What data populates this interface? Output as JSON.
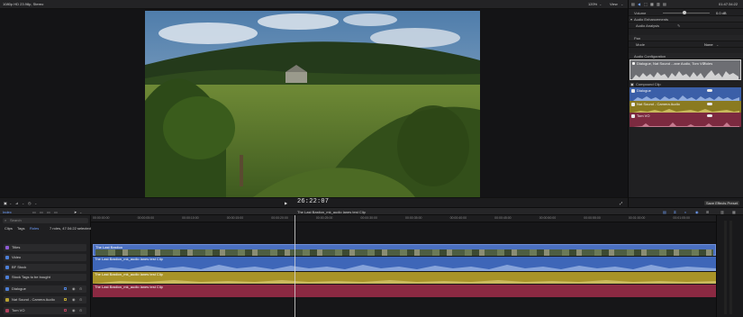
{
  "viewer": {
    "format_label": "1080p HD 23.98p, Stereo",
    "zoom_label": "120%",
    "view_label": "View",
    "timecode": "26:22:07",
    "save_preset_label": "Save Effects Preset"
  },
  "header_right": {
    "duration": "01:47:34:22"
  },
  "inspector": {
    "volume_label": "Volume",
    "volume_value": "0.0 dB",
    "audio_enhancements_label": "Audio Enhancements",
    "audio_analysis_label": "Audio Analysis",
    "pan_label": "Pan",
    "mode_label": "Mode",
    "mode_value": "None",
    "audio_config_label": "Audio Configuration",
    "config_header": "Dialogue, Nat Sound ...ane Audio, Tom VO",
    "config_header_badge": "Roles",
    "compound_clip_label": "Compound Clip",
    "lanes": [
      {
        "label": "Dialogue",
        "color": "#3b5fa8"
      },
      {
        "label": "Nat Sound - Camera Audio",
        "color": "#8a7a20"
      },
      {
        "label": "Tom VO",
        "color": "#7c2a40"
      }
    ]
  },
  "toolbar": {
    "index_label": "Index",
    "clip_name": "The Last Bastion_mk_audio lanes test Clip"
  },
  "index_panel": {
    "search_placeholder": "Search",
    "tabs": [
      "Clips",
      "Tags",
      "Roles"
    ],
    "summary": "7 roles, 47:34:22 selected",
    "roles": [
      {
        "label": "Titles",
        "color": "#8e5bd4"
      },
      {
        "label": "Video",
        "color": "#4d7fd6"
      },
      {
        "label": "BF Stock",
        "color": "#4d7fd6"
      },
      {
        "label": "Stock Tags to be bought",
        "color": "#4d7fd6"
      },
      {
        "label": "Dialogue",
        "color": "#4d7fd6"
      },
      {
        "label": "Nat Sound - Camera Audio",
        "color": "#b8a232"
      },
      {
        "label": "Tom VO",
        "color": "#b0415c"
      }
    ]
  },
  "timeline": {
    "ruler_ticks": [
      "00:00:00:00",
      "00:00:05:00",
      "00:00:10:00",
      "00:00:15:00",
      "00:00:20:00",
      "00:00:25:00",
      "00:00:30:00",
      "00:00:35:00",
      "00:00:40:00",
      "00:00:45:00",
      "00:00:50:00",
      "00:00:55:00",
      "00:01:00:00",
      "00:01:05:00"
    ],
    "video_clip_label": "The Last Bastion",
    "dialogue_clip_label": "The Last Bastion_mk_audio lanes test Clip",
    "nat_clip_label": "The Last Bastion_mk_audio lanes test Clip",
    "vo_clip_label": "The Last Bastion_mk_audio lanes test Clip",
    "colors": {
      "video": "#4a6fc0",
      "dialogue": "#3e66b8",
      "nat": "#a89328",
      "vo": "#8b2942"
    }
  }
}
